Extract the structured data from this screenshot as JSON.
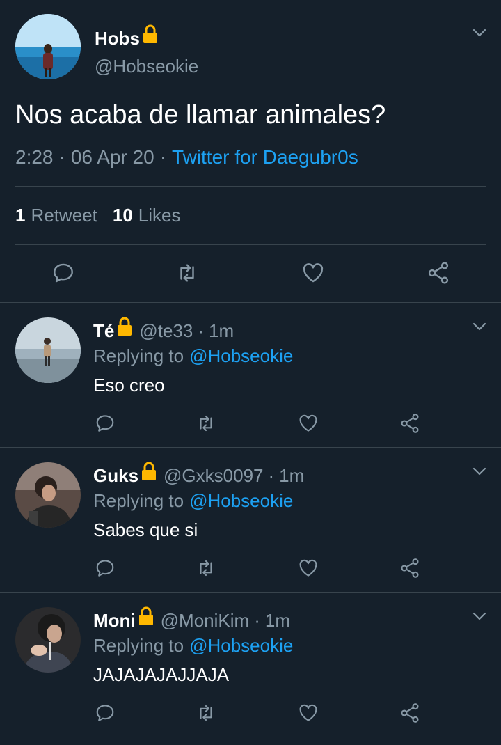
{
  "tweet": {
    "name": "Hobs",
    "handle": "@Hobseokie",
    "text": "Nos acaba de llamar animales?",
    "time": "2:28",
    "date": "06 Apr 20",
    "client": "Twitter for Daegubr0s",
    "retweet_count": "1",
    "retweet_label": "Retweet",
    "likes_count": "10",
    "likes_label": "Likes"
  },
  "separator": "·",
  "replies": [
    {
      "name": "Té",
      "handle": "@te33",
      "time": "1m",
      "replying_label": "Replying to",
      "replying_to": "@Hobseokie",
      "text": "Eso creo"
    },
    {
      "name": "Guks",
      "handle": "@Gxks0097",
      "time": "1m",
      "replying_label": "Replying to",
      "replying_to": "@Hobseokie",
      "text": "Sabes que si"
    },
    {
      "name": "Moni",
      "handle": "@MoniKim",
      "time": "1m",
      "replying_label": "Replying to",
      "replying_to": "@Hobseokie",
      "text": "JAJAJAJAJJAJA"
    }
  ],
  "icons": {
    "lock": "lock-icon",
    "chevron": "chevron-down-icon",
    "reply": "reply-icon",
    "retweet": "retweet-icon",
    "like": "heart-icon",
    "share": "share-icon"
  },
  "colors": {
    "background": "#15202b",
    "accent": "#1da1f2",
    "secondary_text": "#8899a6",
    "divider": "#38444d",
    "lock": "#ffb800"
  }
}
